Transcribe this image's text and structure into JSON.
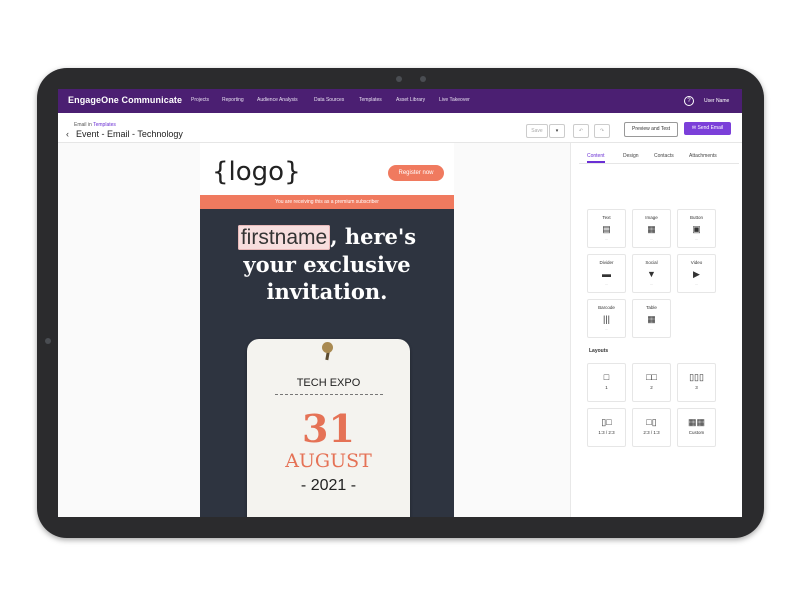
{
  "nav": {
    "brand": "EngageOne Communicate",
    "items": [
      "Projects",
      "Reporting",
      "Audience Analysis",
      "Data Sources",
      "Templates",
      "Asset Library",
      "Live Takeover"
    ],
    "help_icon": "?",
    "user_name": "User Name"
  },
  "header": {
    "breadcrumb_prefix": "Email in",
    "breadcrumb_link": "Templates",
    "title": "Event - Email - Technology",
    "save_label": "Save",
    "preview_label": "Preview and Test",
    "send_label": "Send Email"
  },
  "email": {
    "logo": "{logo}",
    "register_label": "Register now",
    "premium_text": "You are receiving this as a premium subscriber",
    "personalization_field": "firstname",
    "headline_rest_1": ", here's",
    "headline_line_2": "your exclusive",
    "headline_line_3": "invitation.",
    "ticket": {
      "title": "TECH EXPO",
      "day": "31",
      "month": "AUGUST",
      "year": "- 2021 -"
    },
    "colors": {
      "accent": "#f07a5f",
      "hero_bg": "#2e3440"
    }
  },
  "panel": {
    "tabs": [
      "Content",
      "Design",
      "Contacts",
      "Attachments"
    ],
    "active_tab": "Content",
    "content_blocks": [
      {
        "label": "Text",
        "icon": "text-icon"
      },
      {
        "label": "Image",
        "icon": "image-icon"
      },
      {
        "label": "Button",
        "icon": "button-icon"
      },
      {
        "label": "Divider",
        "icon": "divider-icon"
      },
      {
        "label": "Social",
        "icon": "social-icon"
      },
      {
        "label": "Video",
        "icon": "video-icon"
      },
      {
        "label": "Barcode",
        "icon": "barcode-icon"
      },
      {
        "label": "Table",
        "icon": "table-icon"
      }
    ],
    "layouts_title": "Layouts",
    "layouts": [
      "1",
      "2",
      "3",
      "1:3 / 2:3",
      "2:3 / 1:3",
      "Custom"
    ]
  },
  "theme": {
    "nav_bg": "#4b1f72",
    "primary": "#7b3fd9"
  }
}
